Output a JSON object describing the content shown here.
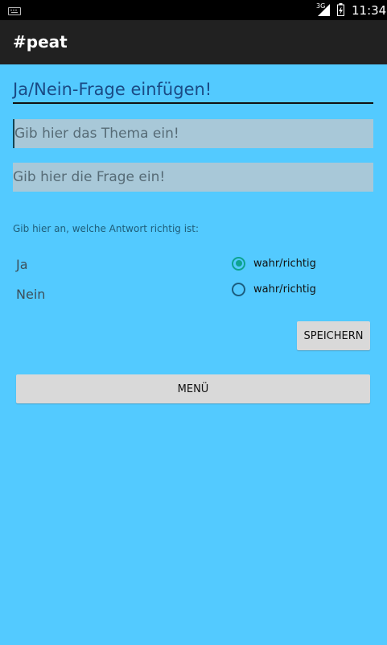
{
  "status_bar": {
    "network": "3G",
    "time": "11:34"
  },
  "app_bar": {
    "title": "#peat"
  },
  "form": {
    "heading": "Ja/Nein-Frage einfügen!",
    "topic_placeholder": "Gib hier das Thema ein!",
    "question_placeholder": "Gib hier die Frage ein!",
    "hint": "Gib hier an, welche Antwort richtig ist:",
    "answers": [
      {
        "label": "Ja",
        "radio_label": "wahr/richtig",
        "checked": true
      },
      {
        "label": "Nein",
        "radio_label": "wahr/richtig",
        "checked": false
      }
    ],
    "save_label": "SPEICHERN",
    "menu_label": "MENÜ"
  },
  "colors": {
    "background": "#53CAFF",
    "app_bar": "#212121",
    "radio_accent": "#0EA391"
  },
  "icons": [
    "keyboard-icon",
    "signal-icon",
    "battery-icon"
  ]
}
